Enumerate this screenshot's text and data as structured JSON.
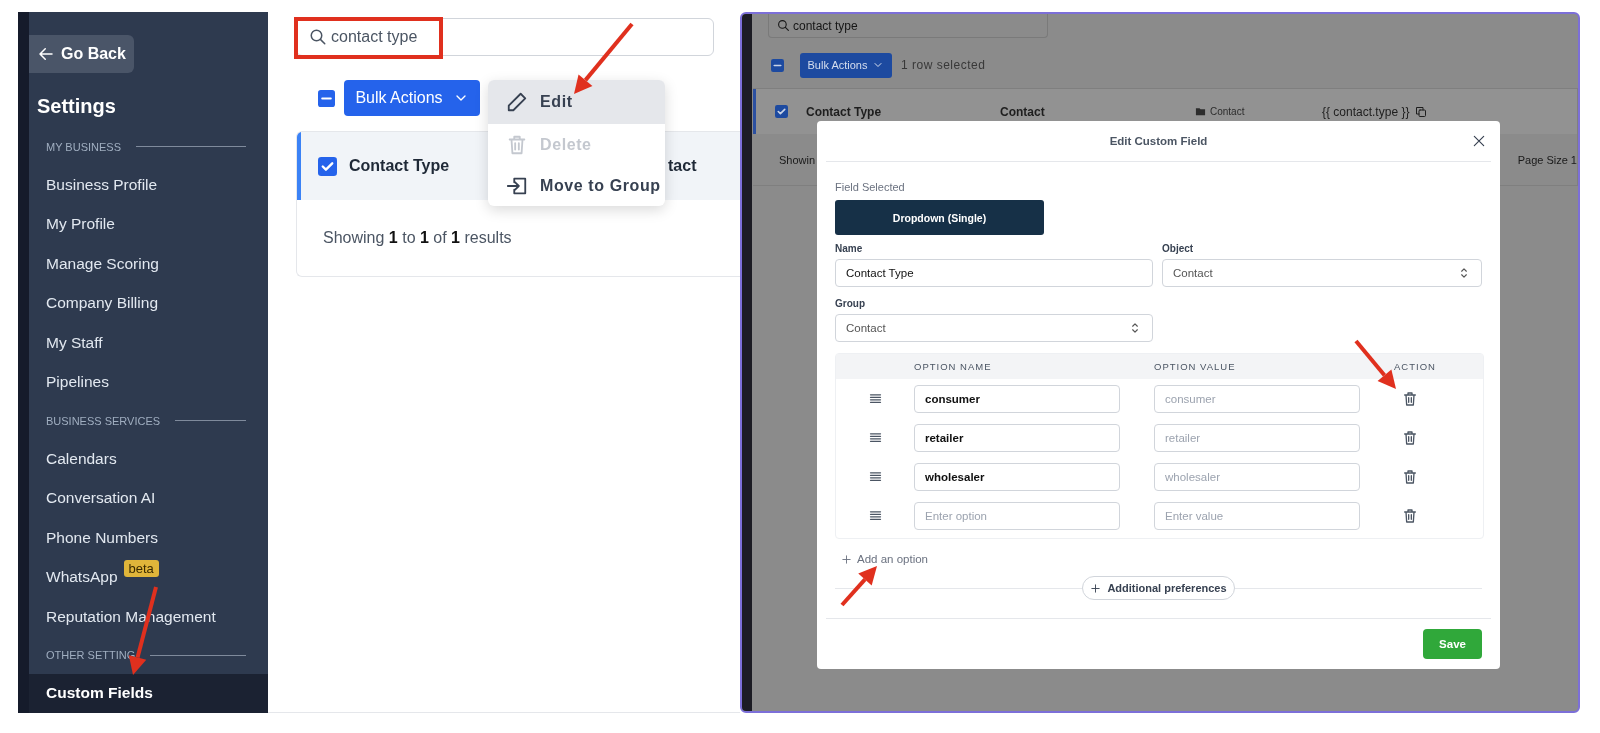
{
  "left_screen": {
    "sidebar": {
      "back_button": "Go Back",
      "title": "Settings",
      "sections": [
        {
          "heading": "MY BUSINESS",
          "items": [
            {
              "label": "Business Profile",
              "selected": false
            },
            {
              "label": "My Profile",
              "selected": false
            },
            {
              "label": "Manage Scoring",
              "selected": false
            },
            {
              "label": "Company Billing",
              "selected": false
            },
            {
              "label": "My Staff",
              "selected": false
            },
            {
              "label": "Pipelines",
              "selected": false
            }
          ]
        },
        {
          "heading": "BUSINESS SERVICES",
          "items": [
            {
              "label": "Calendars",
              "selected": false
            },
            {
              "label": "Conversation AI",
              "selected": false
            },
            {
              "label": "Phone Numbers",
              "selected": false
            },
            {
              "label": "WhatsApp",
              "badge": "beta",
              "selected": false
            },
            {
              "label": "Reputation Management",
              "selected": false
            }
          ]
        },
        {
          "heading": "OTHER SETTING",
          "items": [
            {
              "label": "Custom Fields",
              "selected": true
            }
          ]
        }
      ]
    },
    "search": {
      "value": "contact type"
    },
    "select_all_indeterminate": true,
    "bulk_button": "Bulk Actions",
    "menu": [
      {
        "label": "Edit",
        "highlighted": true,
        "disabled": false
      },
      {
        "label": "Delete",
        "highlighted": false,
        "disabled": true
      },
      {
        "label": "Move to Group",
        "highlighted": false,
        "disabled": false
      }
    ],
    "row": {
      "checked": true,
      "name": "Contact Type",
      "object": "tact"
    },
    "summary": "Showing **1** to **1** of **1** results"
  },
  "right_screen": {
    "page": {
      "search": {
        "value": "contact type"
      },
      "select_all_indeterminate": true,
      "bulk_button": "Bulk Actions",
      "selection_count": "1 row selected",
      "row": {
        "checked": true,
        "name": "Contact Type",
        "object": "Contact",
        "group": "Contact",
        "key": "{{ contact.type }}"
      },
      "summary": "Showin",
      "page_size": "Page Size 1"
    },
    "modal": {
      "title": "Edit Custom Field",
      "field_selected_label": "Field Selected",
      "field_type": "Dropdown (Single)",
      "name": {
        "label": "Name",
        "value": "Contact Type"
      },
      "object": {
        "label": "Object",
        "value": "Contact"
      },
      "group": {
        "label": "Group",
        "value": "Contact"
      },
      "options_table": {
        "columns": [
          "OPTION NAME",
          "OPTION VALUE",
          "ACTION"
        ],
        "rows": [
          {
            "option_name": {
              "value": "consumer"
            },
            "option_value": {
              "placeholder": "consumer"
            }
          },
          {
            "option_name": {
              "value": "retailer"
            },
            "option_value": {
              "placeholder": "retailer"
            }
          },
          {
            "option_name": {
              "value": "wholesaler"
            },
            "option_value": {
              "placeholder": "wholesaler"
            }
          },
          {
            "option_name": {
              "placeholder": "Enter option"
            },
            "option_value": {
              "placeholder": "Enter value"
            }
          }
        ]
      },
      "add_option": "Add an option",
      "additional_preferences": "Additional preferences",
      "save_button": "Save"
    }
  }
}
